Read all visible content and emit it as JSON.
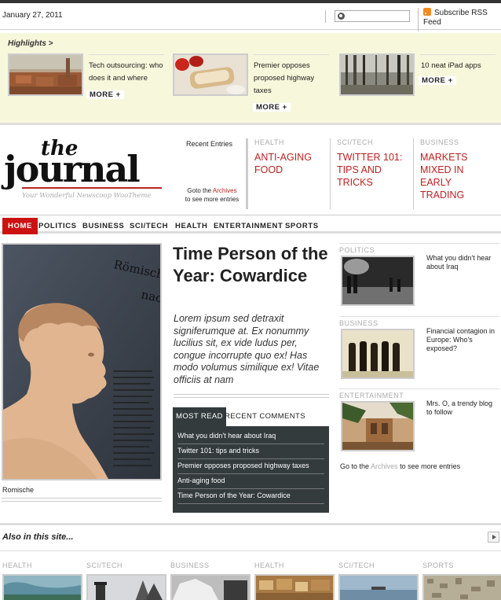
{
  "header": {
    "date": "January 27, 2011",
    "search_placeholder": "",
    "rss_label": "Subscribe RSS Feed"
  },
  "highlights": {
    "title": "Highlights >",
    "items": [
      {
        "text": "Tech outsourcing: who does it and where",
        "more": "MORE +"
      },
      {
        "text": "Premier opposes proposed highway taxes",
        "more": "MORE +"
      },
      {
        "text": "10 neat iPad apps",
        "more": "MORE +"
      }
    ]
  },
  "logo": {
    "the": "the",
    "journal": "journal",
    "tagline": "Your Wonderful Newscoop WooTheme"
  },
  "recent_entries": {
    "label": "Recent Entries",
    "goto_prefix": "Goto the ",
    "archives": "Archives",
    "goto_suffix": "to see more entries",
    "columns": [
      {
        "category": "HEALTH",
        "title": "Anti-aging food"
      },
      {
        "category": "SCI/TECH",
        "title": "Twitter 101: tips and tricks"
      },
      {
        "category": "BUSINESS",
        "title": "Markets mixed in early trading"
      }
    ]
  },
  "nav": {
    "items": [
      "HOME",
      "POLITICS",
      "BUSINESS",
      "SCI/TECH",
      "HEALTH",
      "ENTERTAINMENT",
      "SPORTS"
    ]
  },
  "feature": {
    "caption": "Romische",
    "image_text": "Römische nach",
    "headline": "Time Person of the Year: Cowardice",
    "lede": "Lorem ipsum sed detraxit signiferumque at. Ex nonummy lucilius sit, ex vide ludus per, congue incorrupte quo ex! Has modo volumus similique ex! Vitae officiis at nam"
  },
  "tabs": {
    "most_read": "MOST READ",
    "recent_comments": "RECENT COMMENTS",
    "items": [
      "What you didn't hear about Iraq",
      "Twitter 101: tips and tricks",
      "Premier opposes proposed highway taxes",
      "Anti-aging food",
      "Time Person of the Year: Cowardice"
    ]
  },
  "sidebar": {
    "items": [
      {
        "category": "POLITICS",
        "title": "What you didn't hear about Iraq"
      },
      {
        "category": "BUSINESS",
        "title": "Financial contagion in Europe: Who's exposed?"
      },
      {
        "category": "ENTERTAINMENT",
        "title": "Mrs. O, a trendy blog to follow"
      }
    ],
    "goto_prefix": "Go to the",
    "archives": "Archives",
    "goto_suffix": "to see more entries"
  },
  "also": {
    "title": "Also in this site...",
    "categories": [
      "HEALTH",
      "SCI/TECH",
      "BUSINESS",
      "HEALTH",
      "SCI/TECH",
      "SPORTS"
    ]
  },
  "colors": {
    "accent_red": "#cc1111",
    "highlight_bg": "#f7f7dc",
    "tabs_bg": "#333b3d"
  }
}
